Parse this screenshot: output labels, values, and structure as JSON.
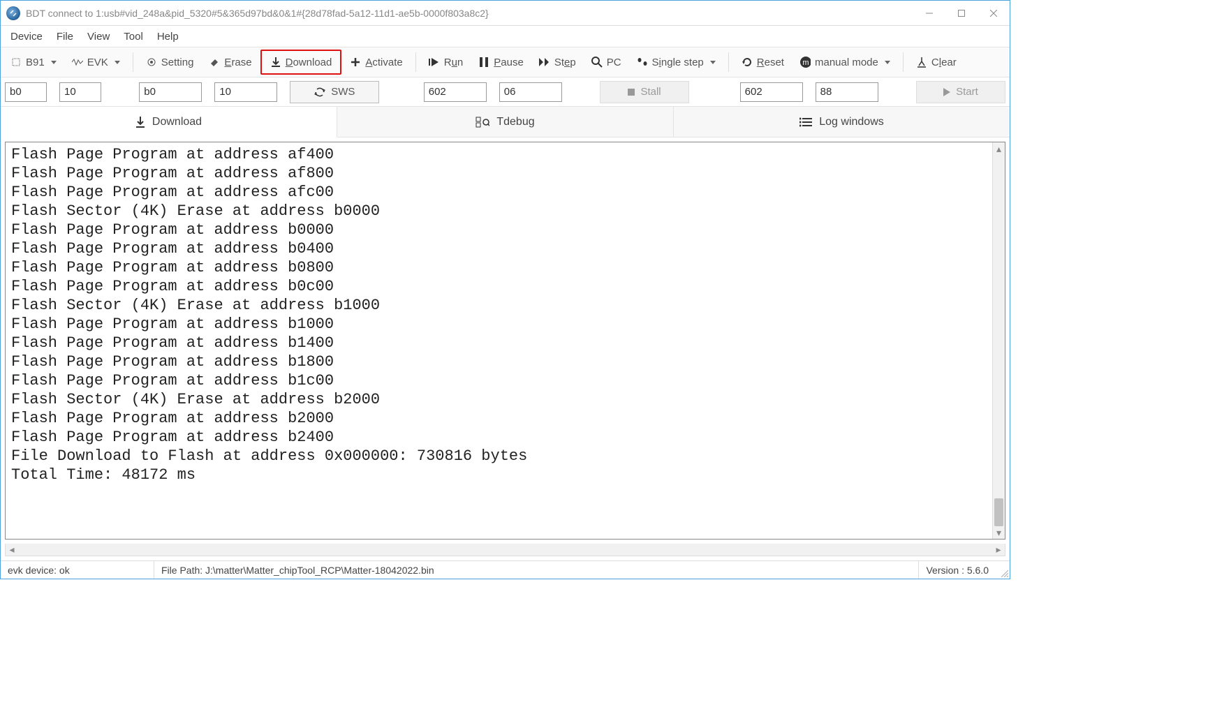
{
  "window": {
    "title": "BDT connect to 1:usb#vid_248a&pid_5320#5&365d97bd&0&1#{28d78fad-5a12-11d1-ae5b-0000f803a8c2}"
  },
  "menu": {
    "items": [
      "Device",
      "File",
      "View",
      "Tool",
      "Help"
    ]
  },
  "toolbar": {
    "chip": "B91",
    "board": "EVK",
    "setting": "Setting",
    "erase": "Erase",
    "download": "Download",
    "activate": "Activate",
    "run": "Run",
    "pause": "Pause",
    "step": "Step",
    "pc": "PC",
    "single_step": "Single step",
    "reset": "Reset",
    "manual_mode": "manual mode",
    "clear": "Clear"
  },
  "row2": {
    "f1": "b0",
    "f2": "10",
    "f3": "b0",
    "f4": "10",
    "sws": "SWS",
    "f5": "602",
    "f6": "06",
    "stall": "Stall",
    "f7": "602",
    "f8": "88",
    "start": "Start"
  },
  "tabs": {
    "download": "Download",
    "tdebug": "Tdebug",
    "log": "Log windows"
  },
  "log_lines": [
    "Flash Page Program at address af400",
    "Flash Page Program at address af800",
    "Flash Page Program at address afc00",
    "Flash Sector (4K) Erase at address b0000",
    "Flash Page Program at address b0000",
    "Flash Page Program at address b0400",
    "Flash Page Program at address b0800",
    "Flash Page Program at address b0c00",
    "Flash Sector (4K) Erase at address b1000",
    "Flash Page Program at address b1000",
    "Flash Page Program at address b1400",
    "Flash Page Program at address b1800",
    "Flash Page Program at address b1c00",
    "Flash Sector (4K) Erase at address b2000",
    "Flash Page Program at address b2000",
    "Flash Page Program at address b2400",
    "File Download to Flash at address 0x000000: 730816 bytes",
    "Total Time: 48172 ms"
  ],
  "status": {
    "device": "evk device: ok",
    "path": "File Path:  J:\\matter\\Matter_chipTool_RCP\\Matter-18042022.bin",
    "version": "Version : 5.6.0"
  }
}
